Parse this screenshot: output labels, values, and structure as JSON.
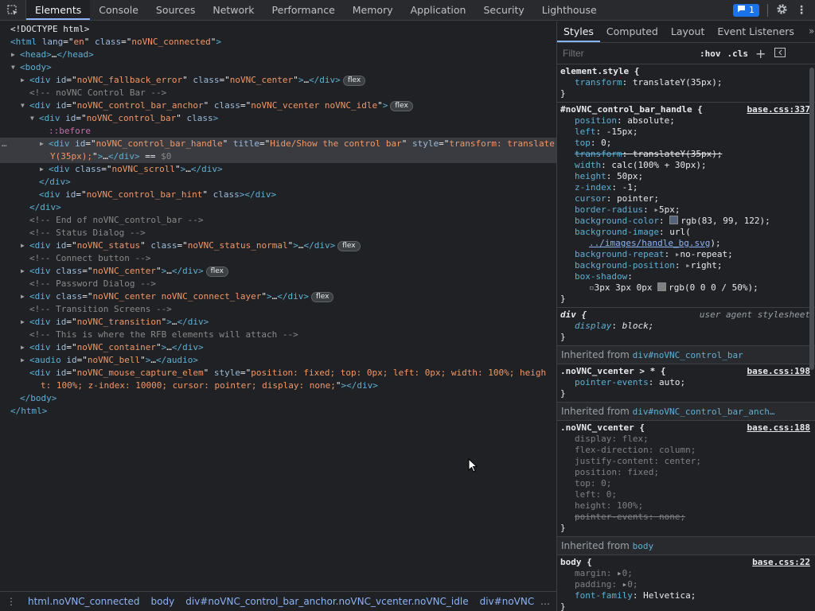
{
  "top_tabs": [
    "Elements",
    "Console",
    "Sources",
    "Network",
    "Performance",
    "Memory",
    "Application",
    "Security",
    "Lighthouse"
  ],
  "issues_count": "1",
  "dom_lines": [
    {
      "indent": 0,
      "parts": [
        [
          "t",
          "<!DOCTYPE html>"
        ]
      ]
    },
    {
      "indent": 0,
      "parts": [
        [
          "tag",
          "<html "
        ],
        [
          "an",
          "lang"
        ],
        [
          "t",
          "=\""
        ],
        [
          "av",
          "en"
        ],
        [
          "t",
          "\" "
        ],
        [
          "an",
          "class"
        ],
        [
          "t",
          "=\""
        ],
        [
          "av",
          "noVNC_connected"
        ],
        [
          "t",
          "\""
        ],
        [
          "tag",
          ">"
        ]
      ]
    },
    {
      "indent": 1,
      "tri": "▶",
      "parts": [
        [
          "tag",
          "<head>"
        ],
        [
          "t",
          "…"
        ],
        [
          "tag",
          "</head>"
        ]
      ]
    },
    {
      "indent": 1,
      "tri": "▼",
      "parts": [
        [
          "tag",
          "<body>"
        ]
      ]
    },
    {
      "indent": 2,
      "tri": "▶",
      "flex": true,
      "parts": [
        [
          "tag",
          "<div "
        ],
        [
          "an",
          "id"
        ],
        [
          "t",
          "=\""
        ],
        [
          "av",
          "noVNC_fallback_error"
        ],
        [
          "t",
          "\" "
        ],
        [
          "an",
          "class"
        ],
        [
          "t",
          "=\""
        ],
        [
          "av",
          "noVNC_center"
        ],
        [
          "t",
          "\""
        ],
        [
          "tag",
          ">"
        ],
        [
          "t",
          "…"
        ],
        [
          "tag",
          "</div>"
        ]
      ]
    },
    {
      "indent": 2,
      "parts": [
        [
          "cm",
          "<!-- noVNC Control Bar -->"
        ]
      ]
    },
    {
      "indent": 2,
      "tri": "▼",
      "flex": true,
      "parts": [
        [
          "tag",
          "<div "
        ],
        [
          "an",
          "id"
        ],
        [
          "t",
          "=\""
        ],
        [
          "av",
          "noVNC_control_bar_anchor"
        ],
        [
          "t",
          "\" "
        ],
        [
          "an",
          "class"
        ],
        [
          "t",
          "=\""
        ],
        [
          "av",
          "noVNC_vcenter noVNC_idle"
        ],
        [
          "t",
          "\""
        ],
        [
          "tag",
          ">"
        ]
      ]
    },
    {
      "indent": 3,
      "tri": "▼",
      "parts": [
        [
          "tag",
          "<div "
        ],
        [
          "an",
          "id"
        ],
        [
          "t",
          "=\""
        ],
        [
          "av",
          "noVNC_control_bar"
        ],
        [
          "t",
          "\" "
        ],
        [
          "an",
          "class"
        ],
        [
          "tag",
          ">"
        ]
      ]
    },
    {
      "indent": 4,
      "parts": [
        [
          "ps",
          "::before"
        ]
      ]
    },
    {
      "indent": 4,
      "tri": "▶",
      "sel": true,
      "parts": [
        [
          "tag",
          "<div "
        ],
        [
          "an",
          "id"
        ],
        [
          "t",
          "=\""
        ],
        [
          "av",
          "noVNC_control_bar_handle"
        ],
        [
          "t",
          "\" "
        ],
        [
          "an",
          "title"
        ],
        [
          "t",
          "=\""
        ],
        [
          "av",
          "Hide/Show the control bar"
        ],
        [
          "t",
          "\" "
        ],
        [
          "an",
          "style"
        ],
        [
          "t",
          "=\""
        ],
        [
          "av",
          "transform: translate"
        ]
      ]
    },
    {
      "indent": 3,
      "cont": true,
      "sel": true,
      "parts": [
        [
          "av",
          "Y(35px);"
        ],
        [
          "t",
          "\""
        ],
        [
          "tag",
          ">"
        ],
        [
          "t",
          "…"
        ],
        [
          "tag",
          "</div>"
        ],
        [
          "t",
          " == "
        ],
        [
          "cm",
          "$0"
        ]
      ]
    },
    {
      "indent": 4,
      "tri": "▶",
      "parts": [
        [
          "tag",
          "<div "
        ],
        [
          "an",
          "class"
        ],
        [
          "t",
          "=\""
        ],
        [
          "av",
          "noVNC_scroll"
        ],
        [
          "t",
          "\""
        ],
        [
          "tag",
          ">"
        ],
        [
          "t",
          "…"
        ],
        [
          "tag",
          "</div>"
        ]
      ]
    },
    {
      "indent": 3,
      "parts": [
        [
          "tag",
          "</div>"
        ]
      ]
    },
    {
      "indent": 3,
      "parts": [
        [
          "tag",
          "<div "
        ],
        [
          "an",
          "id"
        ],
        [
          "t",
          "=\""
        ],
        [
          "av",
          "noVNC_control_bar_hint"
        ],
        [
          "t",
          "\" "
        ],
        [
          "an",
          "class"
        ],
        [
          "tag",
          "></div>"
        ]
      ]
    },
    {
      "indent": 2,
      "parts": [
        [
          "tag",
          "</div>"
        ]
      ]
    },
    {
      "indent": 2,
      "parts": [
        [
          "cm",
          "<!-- End of noVNC_control_bar -->"
        ]
      ]
    },
    {
      "indent": 2,
      "parts": [
        [
          "cm",
          "<!-- Status Dialog -->"
        ]
      ]
    },
    {
      "indent": 2,
      "tri": "▶",
      "flex": true,
      "parts": [
        [
          "tag",
          "<div "
        ],
        [
          "an",
          "id"
        ],
        [
          "t",
          "=\""
        ],
        [
          "av",
          "noVNC_status"
        ],
        [
          "t",
          "\" "
        ],
        [
          "an",
          "class"
        ],
        [
          "t",
          "=\""
        ],
        [
          "av",
          "noVNC_status_normal"
        ],
        [
          "t",
          "\""
        ],
        [
          "tag",
          ">"
        ],
        [
          "t",
          "…"
        ],
        [
          "tag",
          "</div>"
        ]
      ]
    },
    {
      "indent": 2,
      "parts": [
        [
          "cm",
          "<!-- Connect button -->"
        ]
      ]
    },
    {
      "indent": 2,
      "tri": "▶",
      "flex": true,
      "parts": [
        [
          "tag",
          "<div "
        ],
        [
          "an",
          "class"
        ],
        [
          "t",
          "=\""
        ],
        [
          "av",
          "noVNC_center"
        ],
        [
          "t",
          "\""
        ],
        [
          "tag",
          ">"
        ],
        [
          "t",
          "…"
        ],
        [
          "tag",
          "</div>"
        ]
      ]
    },
    {
      "indent": 2,
      "parts": [
        [
          "cm",
          "<!-- Password Dialog -->"
        ]
      ]
    },
    {
      "indent": 2,
      "tri": "▶",
      "flex": true,
      "parts": [
        [
          "tag",
          "<div "
        ],
        [
          "an",
          "class"
        ],
        [
          "t",
          "=\""
        ],
        [
          "av",
          "noVNC_center noVNC_connect_layer"
        ],
        [
          "t",
          "\""
        ],
        [
          "tag",
          ">"
        ],
        [
          "t",
          "…"
        ],
        [
          "tag",
          "</div>"
        ]
      ]
    },
    {
      "indent": 2,
      "parts": [
        [
          "cm",
          "<!-- Transition Screens -->"
        ]
      ]
    },
    {
      "indent": 2,
      "tri": "▶",
      "parts": [
        [
          "tag",
          "<div "
        ],
        [
          "an",
          "id"
        ],
        [
          "t",
          "=\""
        ],
        [
          "av",
          "noVNC_transition"
        ],
        [
          "t",
          "\""
        ],
        [
          "tag",
          ">"
        ],
        [
          "t",
          "…"
        ],
        [
          "tag",
          "</div>"
        ]
      ]
    },
    {
      "indent": 2,
      "parts": [
        [
          "cm",
          "<!-- This is where the RFB elements will attach -->"
        ]
      ]
    },
    {
      "indent": 2,
      "tri": "▶",
      "parts": [
        [
          "tag",
          "<div "
        ],
        [
          "an",
          "id"
        ],
        [
          "t",
          "=\""
        ],
        [
          "av",
          "noVNC_container"
        ],
        [
          "t",
          "\""
        ],
        [
          "tag",
          ">"
        ],
        [
          "t",
          "…"
        ],
        [
          "tag",
          "</div>"
        ]
      ]
    },
    {
      "indent": 2,
      "tri": "▶",
      "parts": [
        [
          "tag",
          "<audio "
        ],
        [
          "an",
          "id"
        ],
        [
          "t",
          "=\""
        ],
        [
          "av",
          "noVNC_bell"
        ],
        [
          "t",
          "\""
        ],
        [
          "tag",
          ">"
        ],
        [
          "t",
          "…"
        ],
        [
          "tag",
          "</audio>"
        ]
      ]
    },
    {
      "indent": 2,
      "parts": [
        [
          "tag",
          "<div "
        ],
        [
          "an",
          "id"
        ],
        [
          "t",
          "=\""
        ],
        [
          "av",
          "noVNC_mouse_capture_elem"
        ],
        [
          "t",
          "\" "
        ],
        [
          "an",
          "style"
        ],
        [
          "t",
          "=\""
        ],
        [
          "av",
          "position: fixed; top: 0px; left: 0px; width: 100%; heigh"
        ]
      ]
    },
    {
      "indent": 2,
      "cont": true,
      "parts": [
        [
          "av",
          "t: 100%; z-index: 10000; cursor: pointer; display: none;"
        ],
        [
          "t",
          "\""
        ],
        [
          "tag",
          "></div>"
        ]
      ]
    },
    {
      "indent": 1,
      "parts": [
        [
          "tag",
          "</body>"
        ]
      ]
    },
    {
      "indent": 0,
      "parts": [
        [
          "tag",
          "</html>"
        ]
      ]
    }
  ],
  "breadcrumbs": [
    {
      "a": "html",
      "b": ".noVNC_connected"
    },
    {
      "a": "body",
      "b": ""
    },
    {
      "a": "div",
      "b": "#noVNC_control_bar_anchor.noVNC_vcenter.noVNC_idle"
    },
    {
      "a": "div",
      "b": "#noVNC_control_b"
    }
  ],
  "side_tabs": [
    "Styles",
    "Computed",
    "Layout",
    "Event Listeners"
  ],
  "filter_placeholder": "Filter",
  "hov_label": ":hov",
  "cls_label": ".cls",
  "styles": [
    {
      "kind": "rule",
      "selector": "element.style {",
      "source": "",
      "lines": [
        {
          "n": "transform",
          "v": "translateY(35px);"
        }
      ]
    },
    {
      "kind": "rule",
      "selector": "#noVNC_control_bar_handle {",
      "source": "base.css:337",
      "lines": [
        {
          "n": "position",
          "v": "absolute;"
        },
        {
          "n": "left",
          "v": "-15px;"
        },
        {
          "n": "top",
          "v": "0;"
        },
        {
          "n": "transform",
          "v": "translateY(35px);",
          "strike": true
        },
        {
          "n": "width",
          "v": "calc(100% + 30px);"
        },
        {
          "n": "height",
          "v": "50px;"
        },
        {
          "n": "z-index",
          "v": "-1;"
        },
        {
          "n": "cursor",
          "v": "pointer;"
        },
        {
          "n": "border-radius",
          "v": "5px;",
          "arrow": true
        },
        {
          "n": "background-color",
          "v": "rgb(83, 99, 122);",
          "swatch": "#53637a"
        },
        {
          "n": "background-image",
          "v": "url("
        },
        {
          "raw": "../images/handle_bg.svg",
          "tail": ");"
        },
        {
          "n": "background-repeat",
          "v": "no-repeat;",
          "arrow": true
        },
        {
          "n": "background-position",
          "v": "right;",
          "arrow": true
        },
        {
          "n": "box-shadow",
          "v": ""
        },
        {
          "raw2": "3px 3px 0px",
          "swatch": "#808080",
          "tail": "rgb(0 0 0 / 50%);"
        }
      ]
    },
    {
      "kind": "rule",
      "selector": "div {",
      "source": "user agent stylesheet",
      "ua": true,
      "lines": [
        {
          "n": "display",
          "v": "block;",
          "italic": true
        }
      ]
    },
    {
      "kind": "inherit",
      "label": "Inherited from ",
      "hl": "div#noVNC_control_bar"
    },
    {
      "kind": "rule",
      "selector": ".noVNC_vcenter > * {",
      "source": "base.css:198",
      "lines": [
        {
          "n": "pointer-events",
          "v": "auto;"
        }
      ]
    },
    {
      "kind": "inherit",
      "label": "Inherited from ",
      "hl": "div#noVNC_control_bar_anch…"
    },
    {
      "kind": "rule",
      "selector": ".noVNC_vcenter {",
      "source": "base.css:188",
      "lines": [
        {
          "n": "display",
          "v": "flex;",
          "ina": true
        },
        {
          "n": "flex-direction",
          "v": "column;",
          "ina": true
        },
        {
          "n": "justify-content",
          "v": "center;",
          "ina": true
        },
        {
          "n": "position",
          "v": "fixed;",
          "ina": true
        },
        {
          "n": "top",
          "v": "0;",
          "ina": true
        },
        {
          "n": "left",
          "v": "0;",
          "ina": true
        },
        {
          "n": "height",
          "v": "100%;",
          "ina": true
        },
        {
          "n": "pointer-events",
          "v": "none;",
          "ina": true,
          "strike": true
        }
      ]
    },
    {
      "kind": "inherit",
      "label": "Inherited from ",
      "hl": "body"
    },
    {
      "kind": "rule",
      "selector": "body {",
      "source": "base.css:22",
      "lines": [
        {
          "n": "margin",
          "v": "0;",
          "ina": true,
          "arrow": true
        },
        {
          "n": "padding",
          "v": "0;",
          "ina": true,
          "arrow": true
        },
        {
          "n": "font-family",
          "v": "Helvetica;"
        }
      ]
    }
  ],
  "colors": {
    "tag": "#5db0d7",
    "attr_name": "#9bbbdc",
    "attr_value": "#f29766",
    "comment": "#898989",
    "accent": "#8ab4f8"
  }
}
